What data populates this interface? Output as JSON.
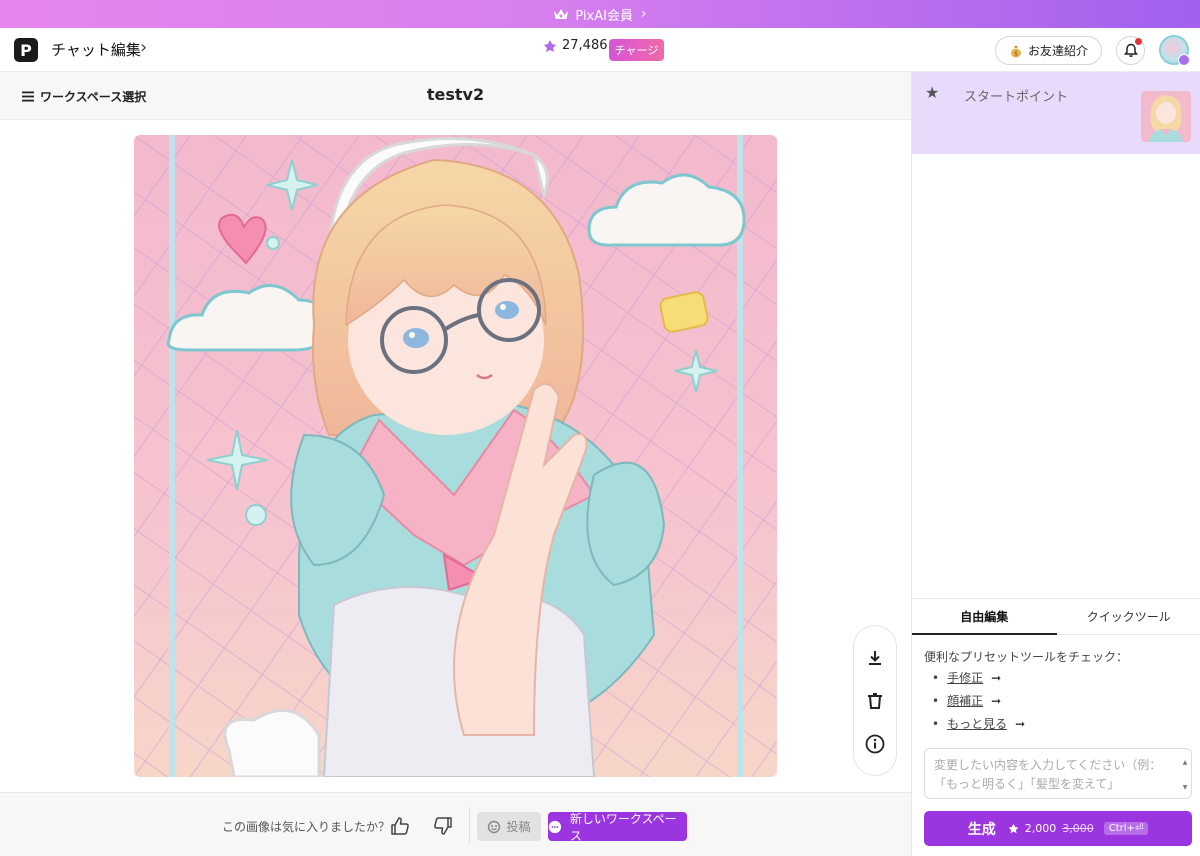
{
  "promo": {
    "label": "PixAI会員",
    "icon": "crown-icon"
  },
  "nav": {
    "logo_letter": "P",
    "title": "チャット編集",
    "credits": "27,486",
    "charge_label": "チャージ",
    "refer_label": "お友達紹介"
  },
  "workspace": {
    "select_label": "ワークスペース選択",
    "title": "testv2"
  },
  "feedback": {
    "question": "この画像は気に入りましたか？",
    "post_label": "投稿",
    "new_workspace_label": "新しいワークスペース"
  },
  "panel": {
    "start_point_label": "スタートポイント",
    "tabs": [
      {
        "label": "自由編集",
        "active": true
      },
      {
        "label": "クイックツール",
        "active": false
      }
    ],
    "preset_heading": "便利なプリセットツールをチェック：",
    "presets": [
      {
        "label": "手修正",
        "arrow": "➞"
      },
      {
        "label": "顔補正",
        "arrow": "➞"
      },
      {
        "label": "もっと見る",
        "arrow": "➞"
      }
    ],
    "prompt_placeholder": "変更したい内容を入力してください（例：「もっと明るく」「髪型を変えて」",
    "generate": {
      "label": "生成",
      "cost": "2,000",
      "original_cost": "3,000",
      "shortcut": "Ctrl+⏎"
    }
  },
  "colors": {
    "accent": "#9b35e0",
    "promo_start": "#e685ee",
    "promo_end": "#a160ee",
    "start_card_bg": "#e8dafa"
  }
}
